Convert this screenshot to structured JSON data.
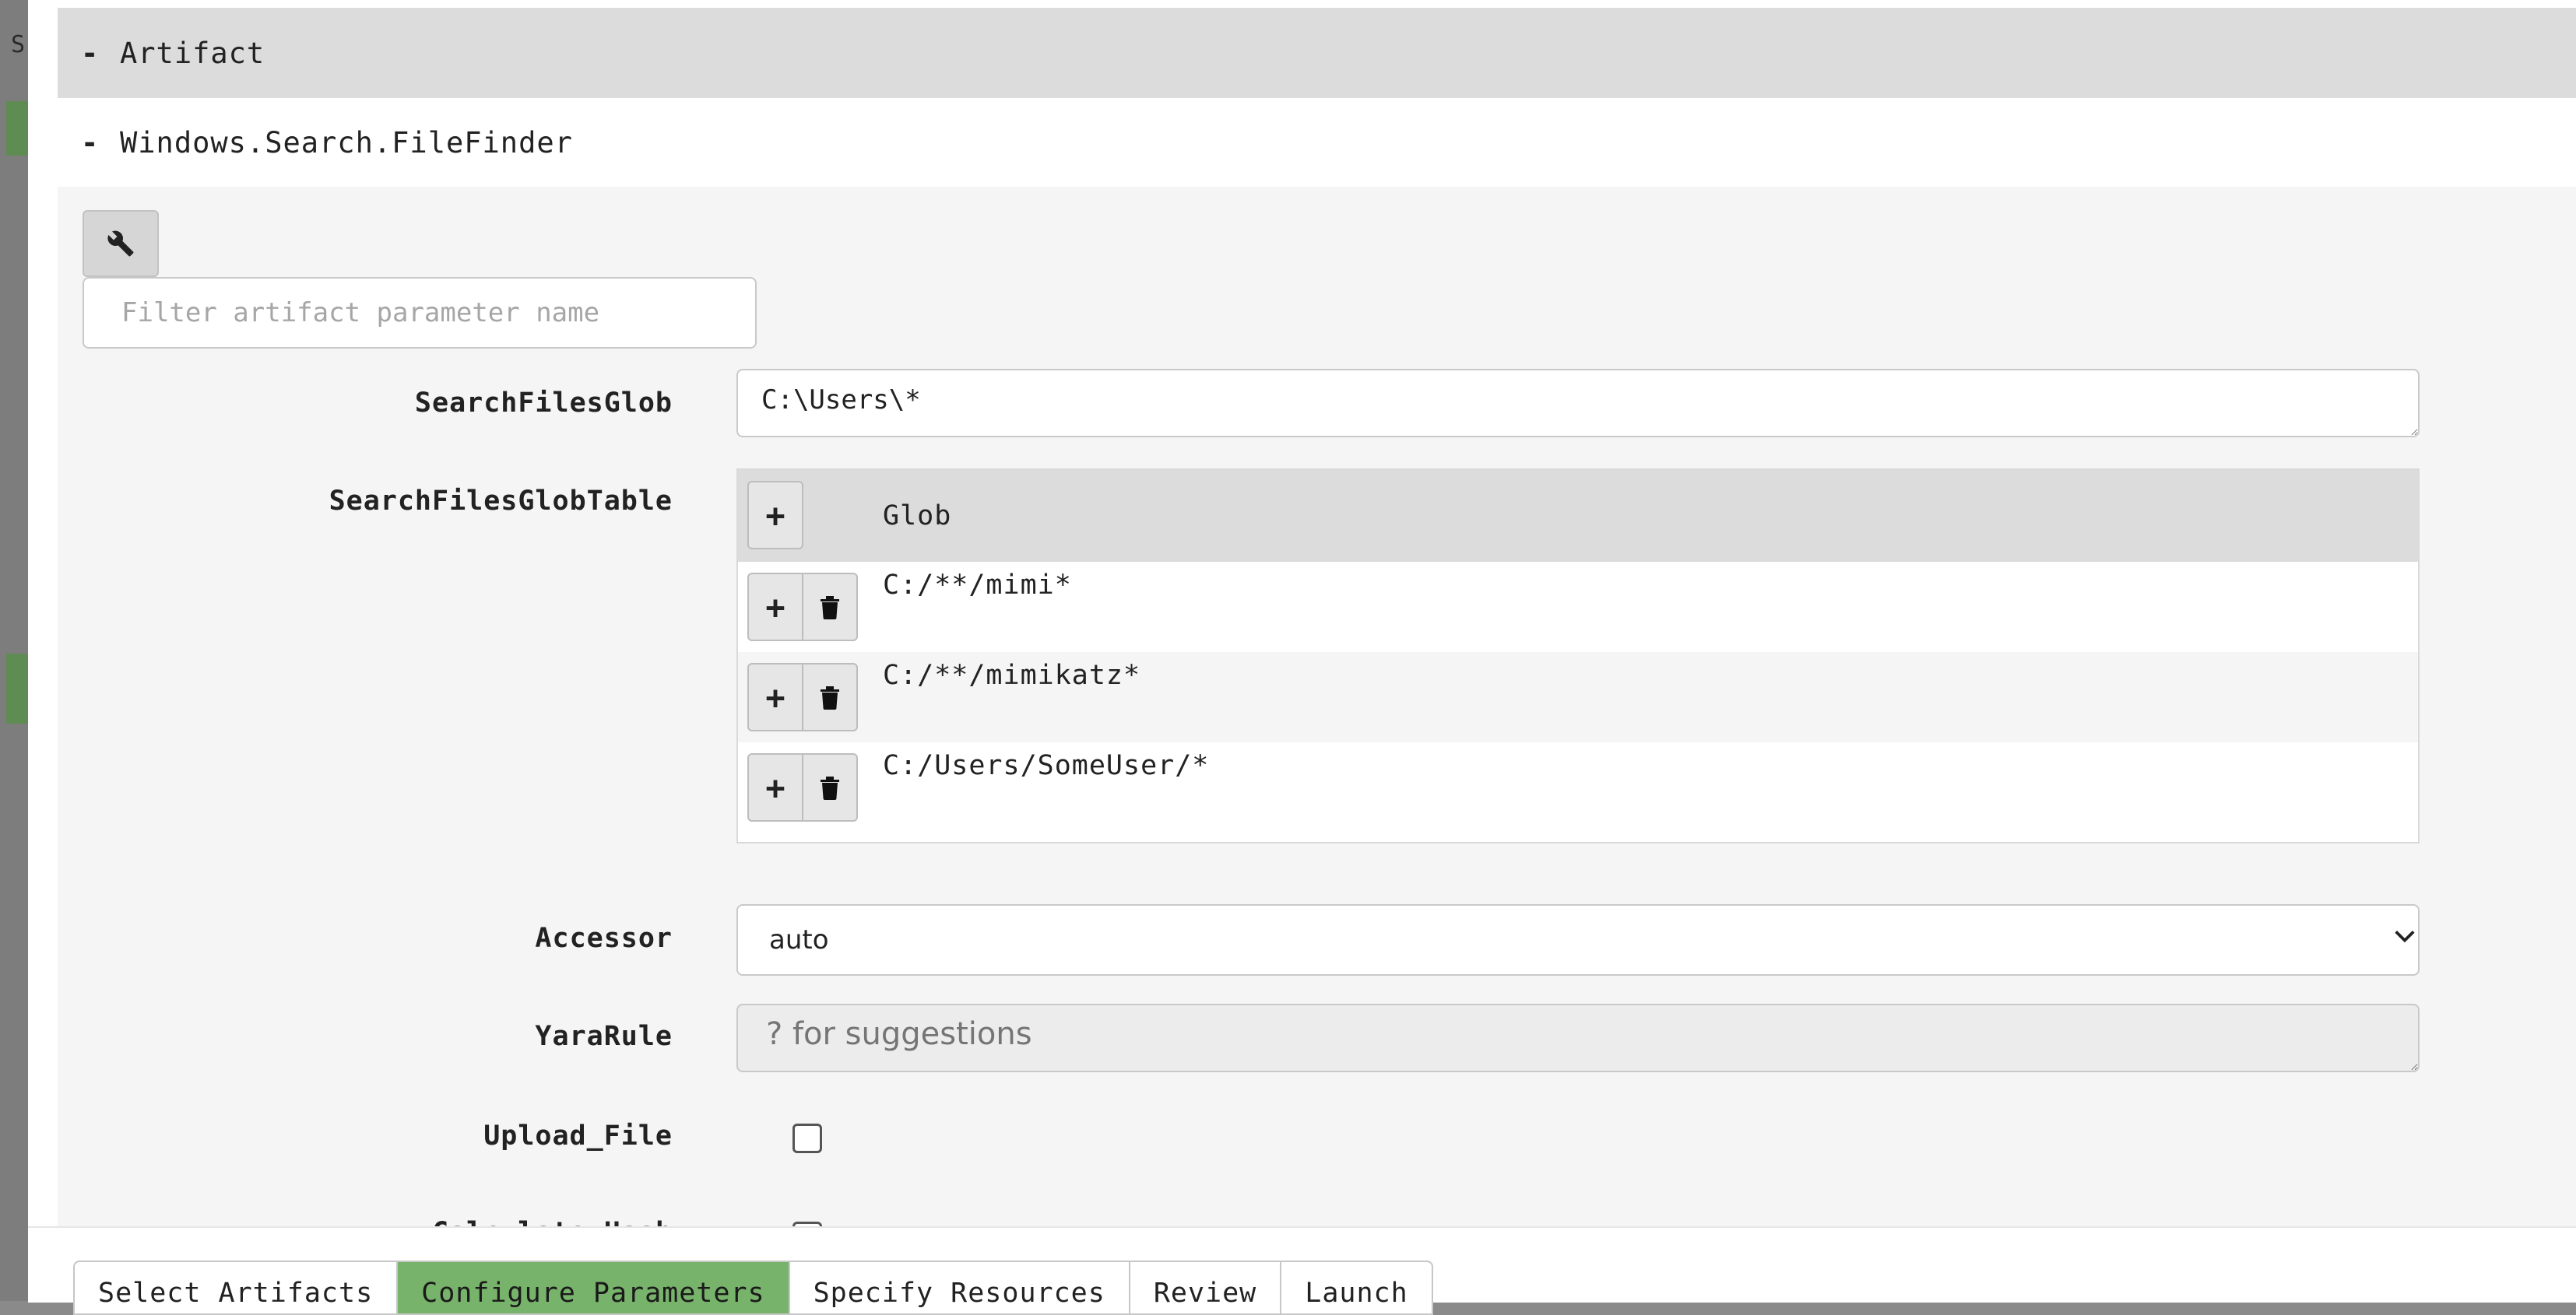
{
  "backdrop": {
    "visible_text": "S"
  },
  "artifact_section": {
    "toggle": "-",
    "title": "Artifact"
  },
  "plugin_section": {
    "toggle": "-",
    "title": "Windows.Search.FileFinder"
  },
  "toolbar": {
    "settings_icon": "wrench-icon"
  },
  "filter": {
    "placeholder": "Filter artifact parameter name"
  },
  "params": {
    "search_files_glob": {
      "label": "SearchFilesGlob",
      "value": "C:\\Users\\*"
    },
    "search_files_glob_table": {
      "label": "SearchFilesGlobTable",
      "column": "Glob",
      "rows": [
        "C:/**/mimi*",
        "C:/**/mimikatz*",
        "C:/Users/SomeUser/*"
      ]
    },
    "accessor": {
      "label": "Accessor",
      "value": "auto",
      "options": [
        "auto"
      ]
    },
    "yara_rule": {
      "label": "YaraRule",
      "placeholder": "? for suggestions"
    },
    "upload_file": {
      "label": "Upload_File",
      "checked": false
    },
    "calculate_hash": {
      "label": "Calculate_Hash",
      "checked": false
    }
  },
  "icons": {
    "add": "+",
    "delete": "trash-icon"
  },
  "wizard": {
    "steps": [
      "Select Artifacts",
      "Configure Parameters",
      "Specify Resources",
      "Review",
      "Launch"
    ],
    "active_step": "Configure Parameters"
  },
  "colors": {
    "active_step": "#78b36b",
    "header_bg": "#dcdcdc"
  }
}
